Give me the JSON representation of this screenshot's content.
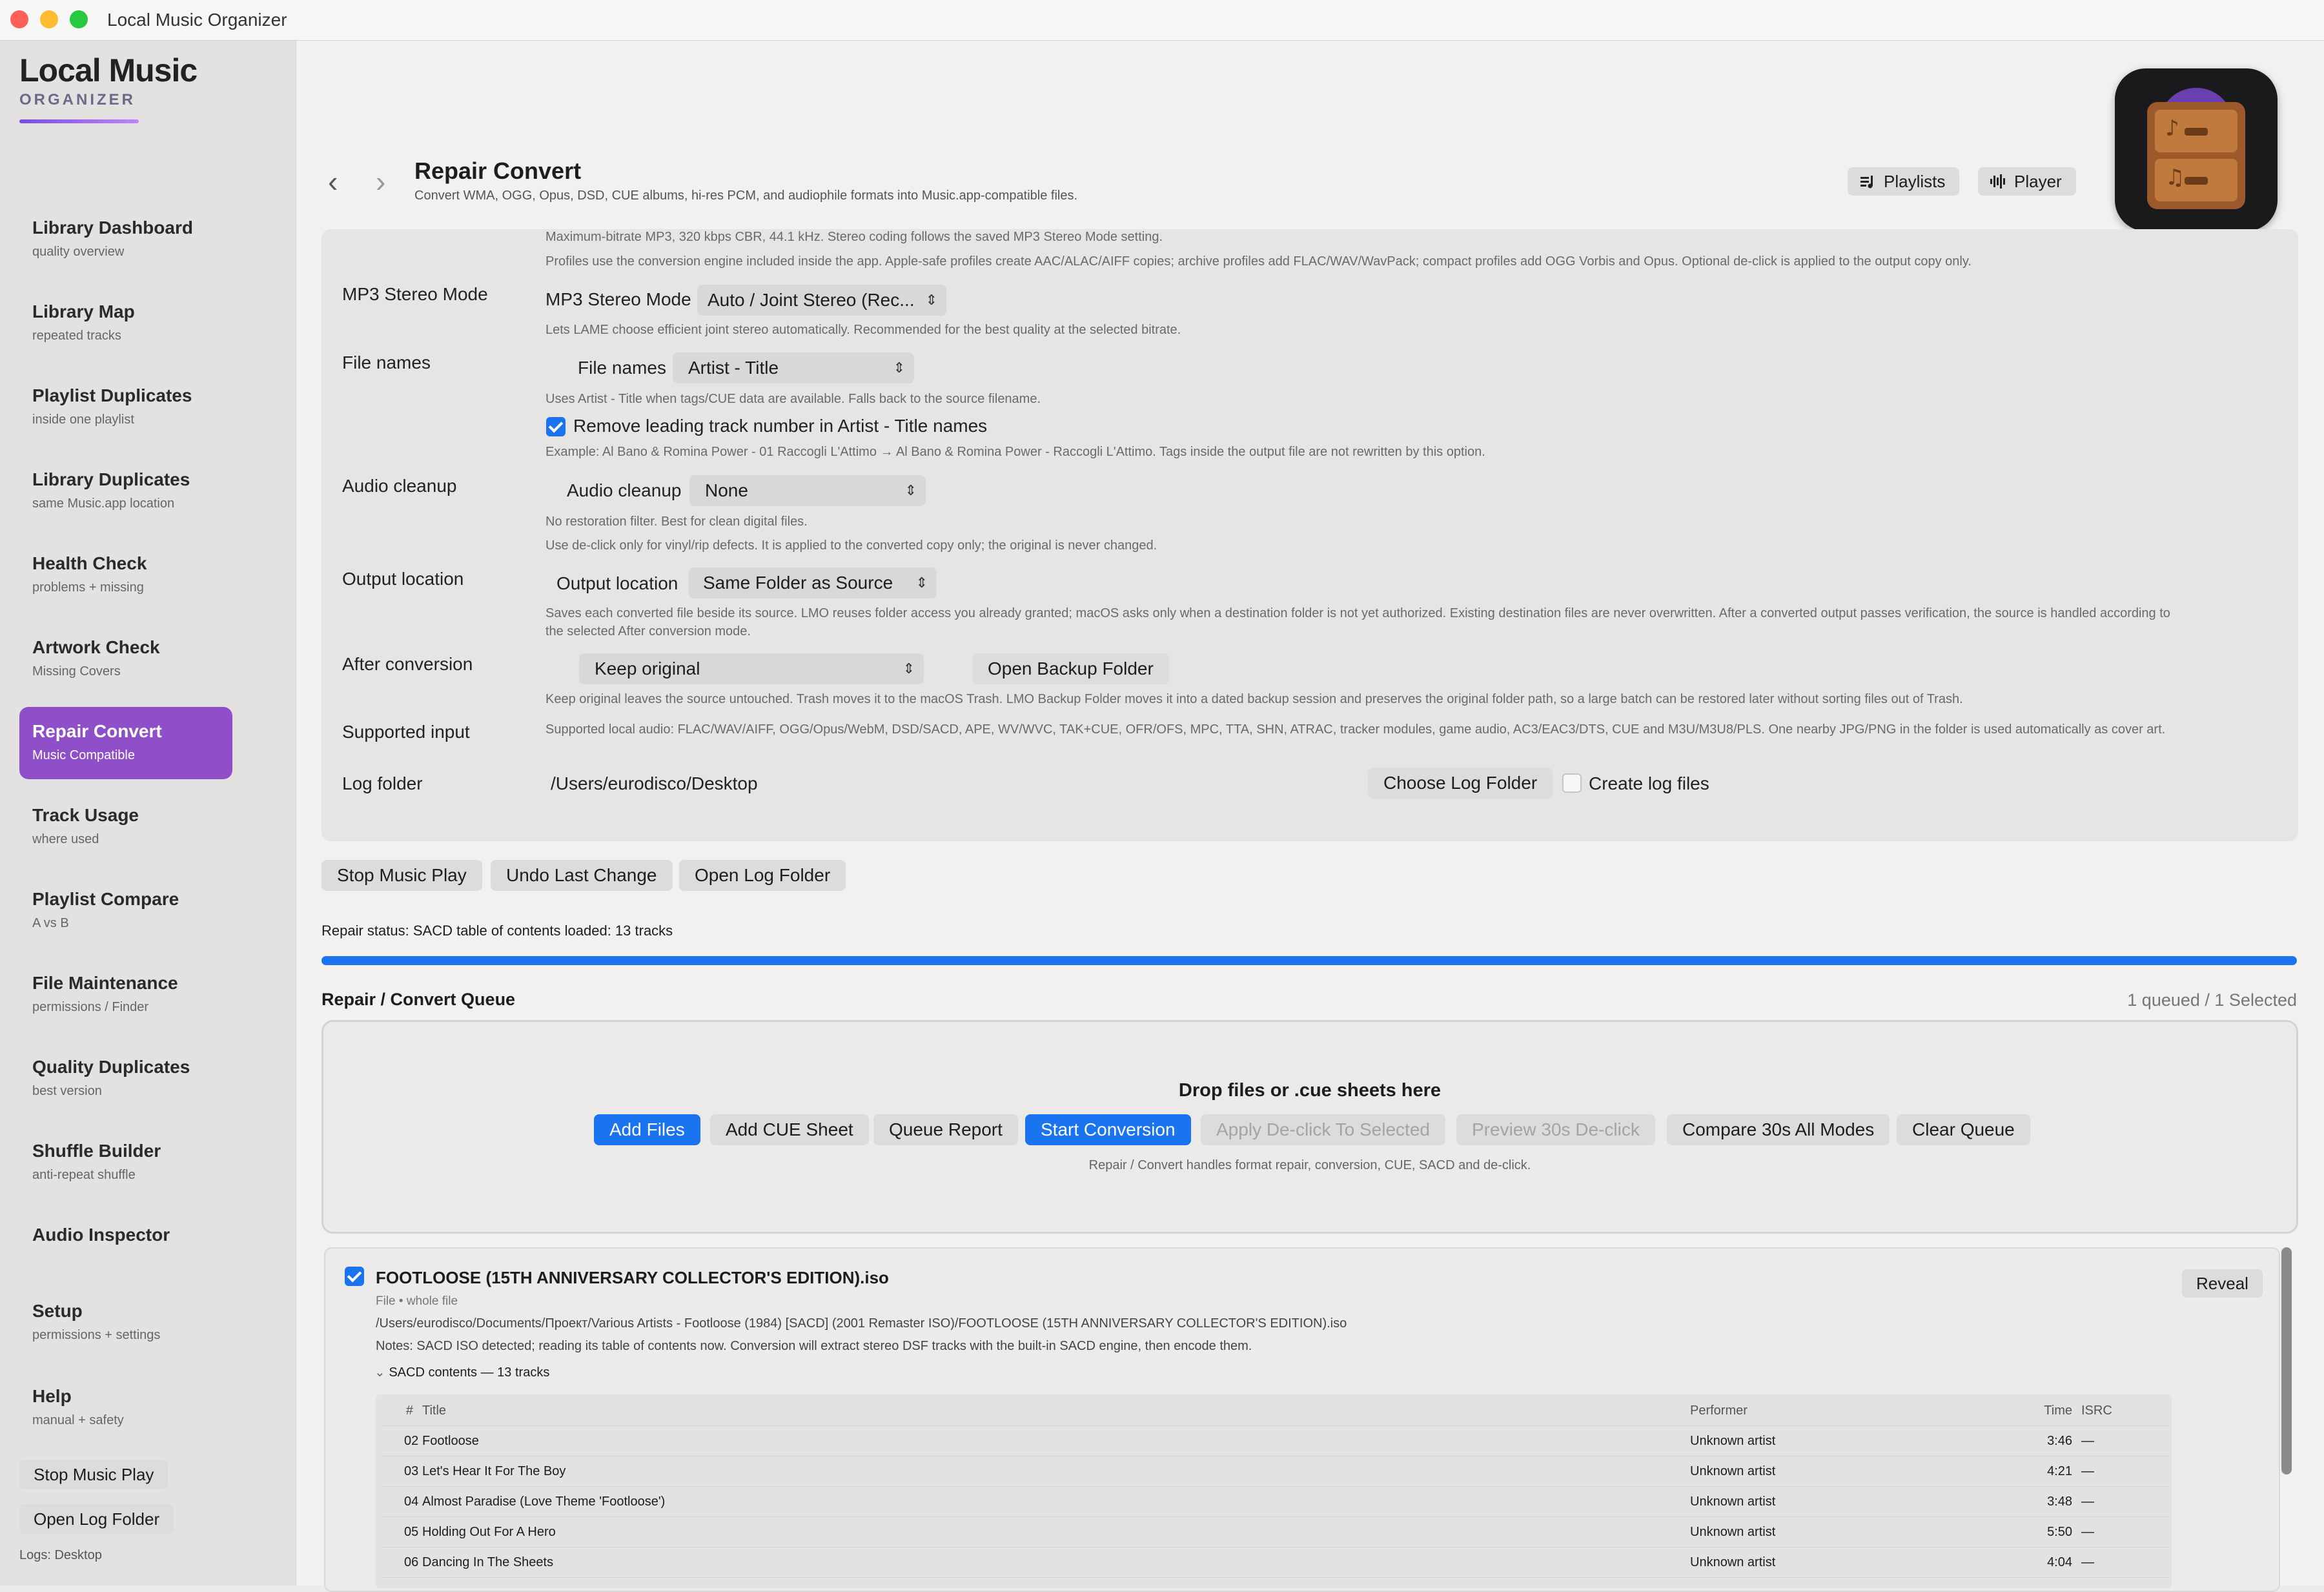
{
  "window": {
    "title": "Local Music Organizer"
  },
  "brand": {
    "title": "Local Music",
    "subtitle": "ORGANIZER"
  },
  "sidebar": {
    "items": [
      {
        "label": "Library Dashboard",
        "sub": "quality overview"
      },
      {
        "label": "Library Map",
        "sub": "repeated tracks"
      },
      {
        "label": "Playlist Duplicates",
        "sub": "inside one playlist"
      },
      {
        "label": "Library Duplicates",
        "sub": "same Music.app location"
      },
      {
        "label": "Health Check",
        "sub": "problems + missing"
      },
      {
        "label": "Artwork Check",
        "sub": "Missing Covers"
      },
      {
        "label": "Repair Convert",
        "sub": "Music Compatible"
      },
      {
        "label": "Track Usage",
        "sub": "where used"
      },
      {
        "label": "Playlist Compare",
        "sub": "A vs B"
      },
      {
        "label": "File Maintenance",
        "sub": "permissions / Finder"
      },
      {
        "label": "Quality Duplicates",
        "sub": "best version"
      },
      {
        "label": "Shuffle Builder",
        "sub": "anti-repeat shuffle"
      },
      {
        "label": "Audio Inspector",
        "sub": ""
      },
      {
        "label": "Setup",
        "sub": "permissions + settings"
      },
      {
        "label": "Help",
        "sub": "manual + safety"
      }
    ],
    "stop_button": "Stop Music Play",
    "open_log_button": "Open Log Folder",
    "logs_note": "Logs: Desktop"
  },
  "header": {
    "title": "Repair Convert",
    "subtitle": "Convert WMA, OGG, Opus, DSD, CUE albums, hi-res PCM, and audiophile formats into Music.app-compatible files.",
    "playlists_button": "Playlists",
    "player_button": "Player",
    "back_glyph": "‹",
    "forward_glyph": "›"
  },
  "settings": {
    "profile_help_1": "Maximum-bitrate MP3, 320 kbps CBR, 44.1 kHz. Stereo coding follows the saved MP3 Stereo Mode setting.",
    "profile_help_2": "Profiles use the conversion engine included inside the app. Apple-safe profiles create AAC/ALAC/AIFF copies; archive profiles add FLAC/WAV/WavPack; compact profiles add OGG Vorbis and Opus. Optional de-click is applied to the output copy only.",
    "mp3_mode": {
      "row_label": "MP3 Stereo Mode",
      "control_label": "MP3 Stereo Mode",
      "value": "Auto / Joint Stereo (Rec...",
      "help": "Lets LAME choose efficient joint stereo automatically. Recommended for the best quality at the selected bitrate."
    },
    "file_names": {
      "row_label": "File names",
      "control_label": "File names",
      "value": "Artist - Title",
      "help": "Uses Artist - Title when tags/CUE data are available. Falls back to the source filename.",
      "checkbox_label": "Remove leading track number in Artist - Title names",
      "example": "Example: Al Bano & Romina Power - 01 Raccogli L'Attimo → Al Bano & Romina Power - Raccogli L'Attimo. Tags inside the output file are not rewritten by this option."
    },
    "audio_cleanup": {
      "row_label": "Audio cleanup",
      "control_label": "Audio cleanup",
      "value": "None",
      "help_1": "No restoration filter. Best for clean digital files.",
      "help_2": "Use de-click only for vinyl/rip defects. It is applied to the converted copy only; the original is never changed."
    },
    "output_location": {
      "row_label": "Output location",
      "control_label": "Output location",
      "value": "Same Folder as Source",
      "help": "Saves each converted file beside its source. LMO reuses folder access you already granted; macOS asks only when a destination folder is not yet authorized. Existing destination files are never overwritten. After a converted output passes verification, the source is handled according to the selected After conversion mode."
    },
    "after_conversion": {
      "row_label": "After conversion",
      "value": "Keep original",
      "backup_button": "Open Backup Folder",
      "help": "Keep original leaves the source untouched. Trash moves it to the macOS Trash. LMO Backup Folder moves it into a dated backup session and preserves the original folder path, so a large batch can be restored later without sorting files out of Trash."
    },
    "supported_input": {
      "row_label": "Supported input",
      "help": "Supported local audio: FLAC/WAV/AIFF, OGG/Opus/WebM, DSD/SACD, APE, WV/WVC, TAK+CUE, OFR/OFS, MPC, TTA, SHN, ATRAC, tracker modules, game audio, AC3/EAC3/DTS, CUE and M3U/M3U8/PLS. One nearby JPG/PNG in the folder is used automatically as cover art."
    },
    "log_folder": {
      "row_label": "Log folder",
      "path": "/Users/eurodisco/Desktop",
      "choose_button": "Choose Log Folder",
      "create_label": "Create log files"
    }
  },
  "actions": {
    "stop": "Stop Music Play",
    "undo": "Undo Last Change",
    "open_log": "Open Log Folder"
  },
  "status": {
    "text": "Repair status: SACD table of contents loaded: 13 tracks",
    "progress": 1.0
  },
  "queue": {
    "title": "Repair / Convert Queue",
    "count": "1 queued / 1 Selected",
    "drop_text": "Drop files or .cue sheets here",
    "buttons": {
      "add_files": "Add Files",
      "add_cue": "Add CUE Sheet",
      "report": "Queue Report",
      "start": "Start Conversion",
      "apply_declick": "Apply De-click To Selected",
      "preview": "Preview 30s De-click",
      "compare": "Compare 30s All Modes",
      "clear": "Clear Queue"
    },
    "caption": "Repair / Convert handles format repair, conversion, CUE, SACD and de-click."
  },
  "item": {
    "name": "FOOTLOOSE (15TH ANNIVERSARY COLLECTOR'S EDITION).iso",
    "kind": "File • whole file",
    "path": "/Users/eurodisco/Documents/Проект/Various Artists - Footloose (1984) [SACD] (2001 Remaster ISO)/FOOTLOOSE (15TH ANNIVERSARY COLLECTOR'S EDITION).iso",
    "notes": "Notes: SACD ISO detected; reading its table of contents now. Conversion will extract stereo DSF tracks with the built-in SACD engine, then encode them.",
    "reveal": "Reveal",
    "sacd_label": "SACD contents — 13 tracks",
    "columns": {
      "num": "#",
      "title": "Title",
      "performer": "Performer",
      "time": "Time",
      "isrc": "ISRC"
    },
    "tracks": [
      {
        "num": "02",
        "title": "Footloose",
        "performer": "Unknown artist",
        "time": "3:46",
        "isrc": "—"
      },
      {
        "num": "03",
        "title": "Let's Hear It For The Boy",
        "performer": "Unknown artist",
        "time": "4:21",
        "isrc": "—"
      },
      {
        "num": "04",
        "title": "Almost Paradise (Love Theme 'Footloose')",
        "performer": "Unknown artist",
        "time": "3:48",
        "isrc": "—"
      },
      {
        "num": "05",
        "title": "Holding Out For A Hero",
        "performer": "Unknown artist",
        "time": "5:50",
        "isrc": "—"
      },
      {
        "num": "06",
        "title": "Dancing In The Sheets",
        "performer": "Unknown artist",
        "time": "4:04",
        "isrc": "—"
      }
    ]
  },
  "colors": {
    "accent": "#1a74f0",
    "sidebar_active": "#8e4fc9"
  }
}
